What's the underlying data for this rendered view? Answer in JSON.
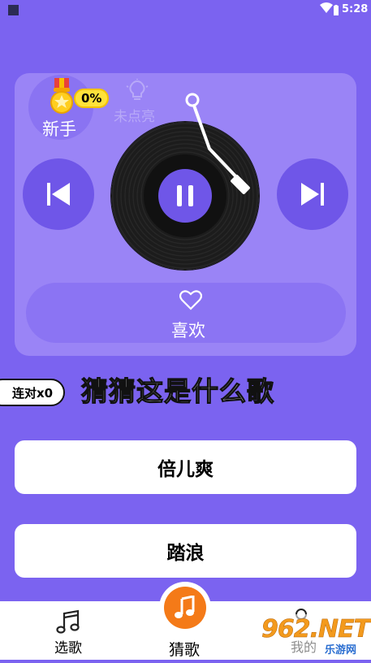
{
  "status_bar": {
    "time": "5:28"
  },
  "badge": {
    "percent": "0%",
    "level_label": "新手"
  },
  "hint": {
    "label": "未点亮"
  },
  "like": {
    "label": "喜欢"
  },
  "streak": {
    "label": "连对x0"
  },
  "question": {
    "text": "猜猜这是什么歌"
  },
  "answers": [
    {
      "label": "倍儿爽"
    },
    {
      "label": "踏浪"
    }
  ],
  "tabbar": {
    "left_label": "选歌",
    "center_label": "猜歌",
    "right_label": "我的"
  },
  "watermark": {
    "brand": "962.NET",
    "site": "乐游网"
  },
  "colors": {
    "background": "#7b63f0",
    "card": "#9a84f6",
    "accent_button": "#6f56e8",
    "center_tab": "#f47a18",
    "badge_yellow": "#ffe23a"
  },
  "icons": [
    "medal-icon",
    "bulb-icon",
    "prev-icon",
    "pause-icon",
    "next-icon",
    "heart-icon",
    "music-note-icon",
    "user-icon",
    "wifi-icon",
    "battery-icon"
  ]
}
